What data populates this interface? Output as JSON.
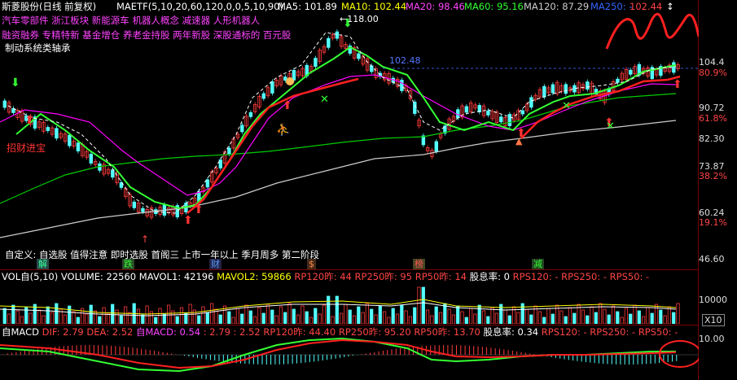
{
  "header": {
    "stock_title": "斯菱股份(日线 前复权)",
    "ma_params": "MAETF(5,10,20,60,120,0,0,5,10,90)",
    "ma5": "MA5: 101.89",
    "ma10": "MA10: 102.44",
    "ma20": "MA20: 98.46",
    "ma60": "MA60: 95.16",
    "ma120": "MA120: 87.29",
    "ma250": "MA250: -",
    "last_val": "102.44",
    "corner_glyph": "↕"
  },
  "concepts": {
    "line1": "汽车零部件 浙江板块 新能源车 机器人概念 减速器 人形机器人",
    "line2": "融资融券 专精特新 基金增仓 养老金持股 两年新股 深股通标的 百元股",
    "line3": "制动系统类轴承"
  },
  "annotations": {
    "high": "118.00",
    "level": "102.48",
    "low_label": "招财进宝",
    "custom_line": "自定义: 自选股 值得注意 即时选股 首阁三 上市一年以上 季月周多 第二阶段",
    "tags": [
      "解",
      "跌",
      "财",
      "$",
      "榜",
      "减"
    ]
  },
  "price_axis": {
    "labels": [
      "104.4",
      "80.9%",
      "90.72",
      "61.8%",
      "82.30",
      "73.87",
      "38.2%",
      "60.24",
      "19.1%",
      "46.60"
    ]
  },
  "volume": {
    "title": "VOL自(5,10)",
    "volume": "VOLUME: 22560",
    "mavol1": "MAVOL1: 42196",
    "mavol2": "MAVOL2: 59866",
    "rp120": "RP120昨: 44",
    "rp250": "RP250昨: 95",
    "rp50": "RP50昨: 14",
    "dividend": "股息率: 0",
    "rps120": "RPS120: -",
    "rps250": "RPS250: -",
    "rps50": "RPS50: -",
    "axis_label": "10000",
    "unit": "X10"
  },
  "macd": {
    "title": "自MACD",
    "dif": "DIF: 2.79",
    "dea": "DEA: 2.52",
    "macd": "自MACD: 0.54",
    "triple": ": 2.79 : 2.52",
    "rp120": "RP120昨: 44.40",
    "rp250": "RP250昨: 95.20",
    "rp50": "RP50昨: 13.70",
    "dividend": "股息率: 0.34",
    "rps120": "RPS120: -",
    "rps250": "RPS250: -",
    "rps50": "RPS50: -",
    "axis_label": "10.00"
  },
  "colors": {
    "bg": "#000000",
    "up": "#ff3b3b",
    "down": "#54ffff",
    "ma5": "#ffffff",
    "ma10": "#ffff00",
    "ma20": "#ff00ff",
    "ma60": "#00cc00",
    "ma120": "#cccccc",
    "concept": "#ff44ff"
  }
}
